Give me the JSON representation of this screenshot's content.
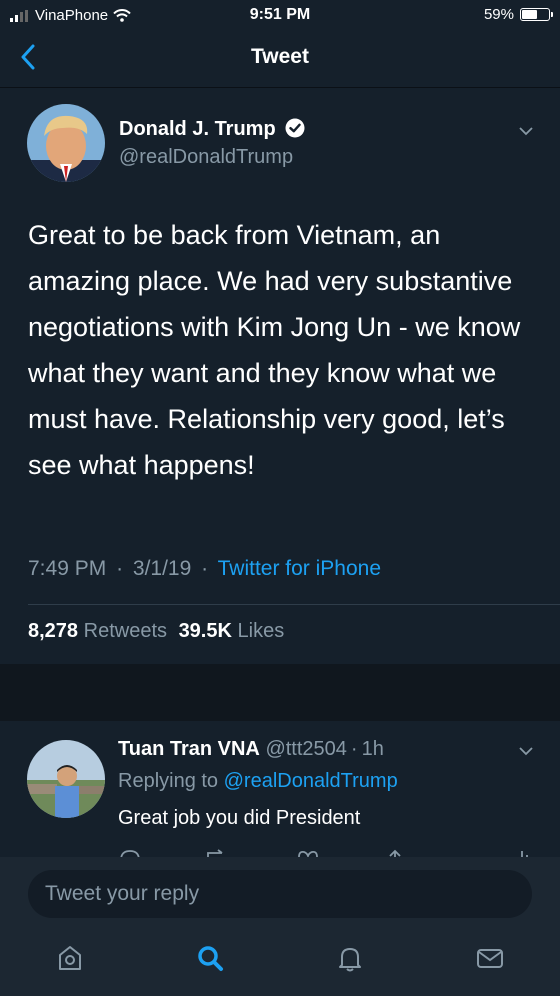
{
  "status_bar": {
    "carrier": "VinaPhone",
    "time": "9:51 PM",
    "battery": "59%",
    "battery_level": 0.59
  },
  "nav": {
    "title": "Tweet",
    "back_icon": "chevron-left-icon"
  },
  "tweet": {
    "author_name": "Donald J. Trump",
    "author_handle": "@realDonaldTrump",
    "verified": true,
    "text": "Great to be back from Vietnam, an amazing place. We had very substantive negotiations with Kim Jong Un - we know what they want and they know what we must have. Relationship very good, let’s see what happens!",
    "time": "7:49 PM",
    "separator": "·",
    "date": "3/1/19",
    "source": "Twitter for iPhone",
    "retweets_count": "8,278",
    "retweets_label": "Retweets",
    "likes_count": "39.5K",
    "likes_label": "Likes"
  },
  "reply": {
    "author_name": "Tuan Tran VNA",
    "author_handle": "@ttt2504",
    "separator": "·",
    "time_ago": "1h",
    "replying_label": "Replying to",
    "replying_handle": "@realDonaldTrump",
    "text": "Great job you did President"
  },
  "composer": {
    "placeholder": "Tweet your reply"
  },
  "tab_bar": {
    "items": [
      "home-icon",
      "search-icon",
      "notifications-icon",
      "messages-icon"
    ],
    "active": "search-icon"
  },
  "colors": {
    "background": "#15202b",
    "accent": "#1da1f2",
    "secondary_text": "#8899a6"
  }
}
